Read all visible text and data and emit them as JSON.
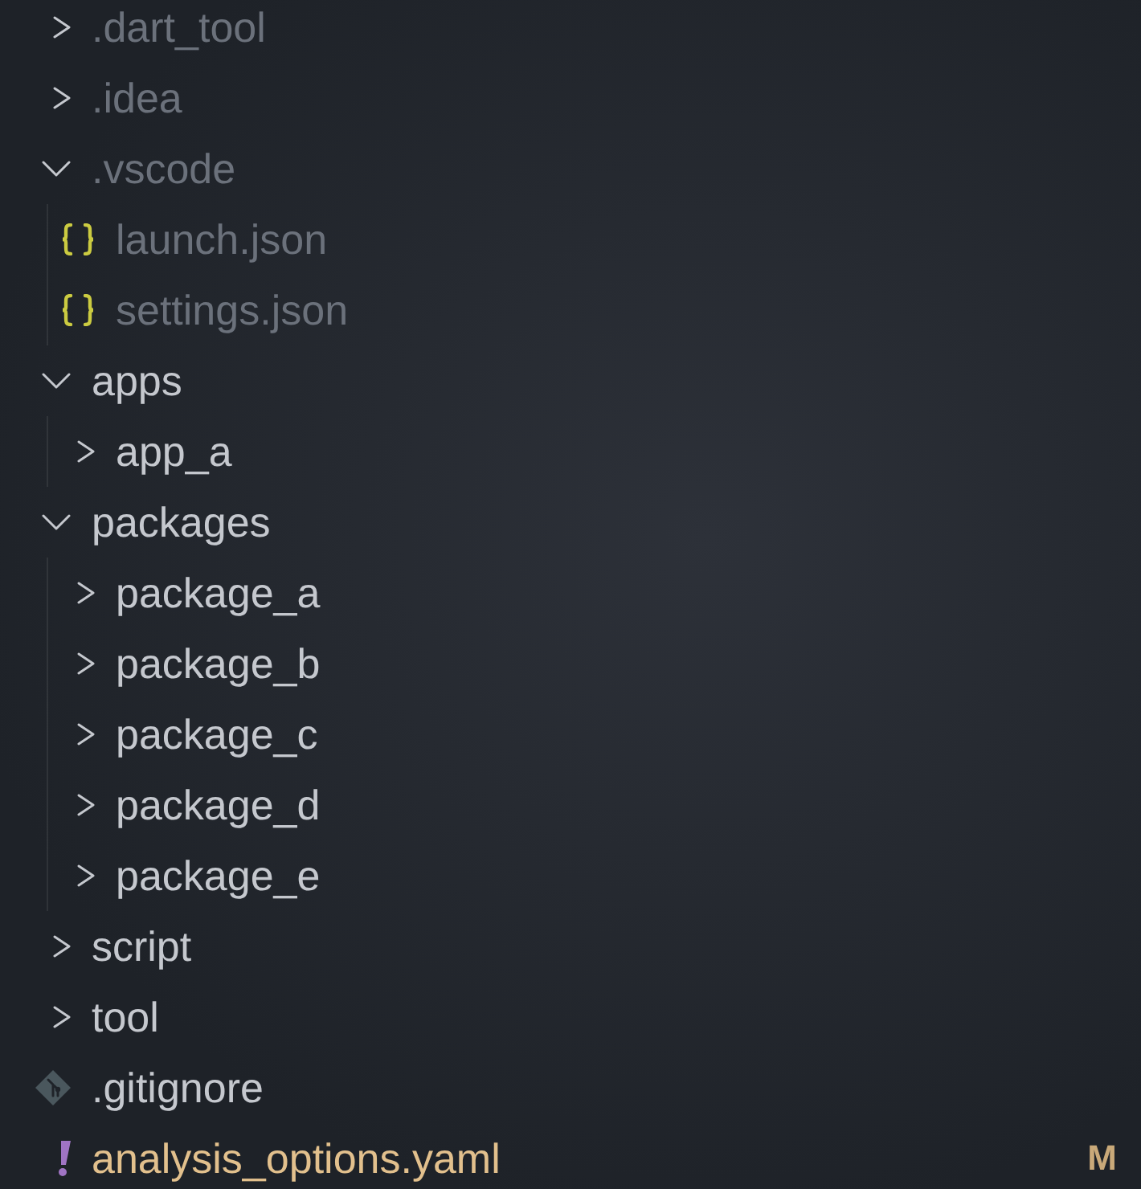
{
  "explorer": {
    "items": [
      {
        "kind": "folder",
        "name": ".dart_tool",
        "expanded": false,
        "ignored": true,
        "modified": false
      },
      {
        "kind": "folder",
        "name": ".idea",
        "expanded": false,
        "ignored": true,
        "modified": false
      },
      {
        "kind": "folder",
        "name": ".vscode",
        "expanded": true,
        "ignored": true,
        "modified": false,
        "children": [
          {
            "kind": "json",
            "name": "launch.json",
            "ignored": true,
            "modified": false
          },
          {
            "kind": "json",
            "name": "settings.json",
            "ignored": true,
            "modified": false
          }
        ]
      },
      {
        "kind": "folder",
        "name": "apps",
        "expanded": true,
        "ignored": false,
        "modified": false,
        "children": [
          {
            "kind": "folder",
            "name": "app_a",
            "expanded": false,
            "ignored": false,
            "modified": false
          }
        ]
      },
      {
        "kind": "folder",
        "name": "packages",
        "expanded": true,
        "ignored": false,
        "modified": false,
        "children": [
          {
            "kind": "folder",
            "name": "package_a",
            "expanded": false,
            "ignored": false,
            "modified": false
          },
          {
            "kind": "folder",
            "name": "package_b",
            "expanded": false,
            "ignored": false,
            "modified": false
          },
          {
            "kind": "folder",
            "name": "package_c",
            "expanded": false,
            "ignored": false,
            "modified": false
          },
          {
            "kind": "folder",
            "name": "package_d",
            "expanded": false,
            "ignored": false,
            "modified": false
          },
          {
            "kind": "folder",
            "name": "package_e",
            "expanded": false,
            "ignored": false,
            "modified": false
          }
        ]
      },
      {
        "kind": "folder",
        "name": "script",
        "expanded": false,
        "ignored": false,
        "modified": false
      },
      {
        "kind": "folder",
        "name": "tool",
        "expanded": false,
        "ignored": false,
        "modified": false
      },
      {
        "kind": "gitignore",
        "name": ".gitignore",
        "ignored": false,
        "modified": false
      },
      {
        "kind": "yaml",
        "name": "analysis_options.yaml",
        "ignored": false,
        "modified": true,
        "badge": "M"
      }
    ]
  }
}
